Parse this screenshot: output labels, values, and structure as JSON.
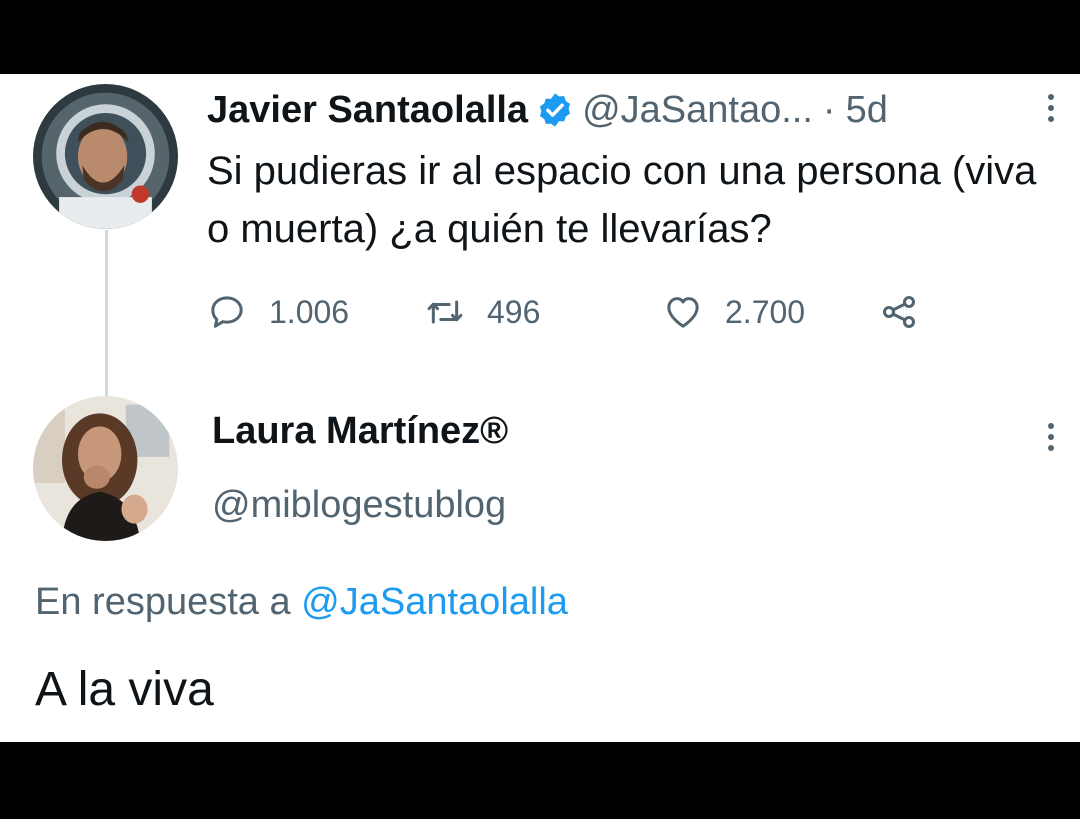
{
  "tweet": {
    "author_name": "Javier Santaolalla",
    "author_handle": "@JaSantao...",
    "separator": "·",
    "age": "5d",
    "text": "Si pudieras ir al espacio con una persona (viva o muerta) ¿a quién te llevarías?",
    "replies": "1.006",
    "retweets": "496",
    "likes": "2.700",
    "verified": true
  },
  "reply": {
    "author_name": "Laura Martínez®",
    "author_handle": "@miblogestublog",
    "replying_prefix": "En respuesta a",
    "replying_to": "@JaSantaolalla",
    "text": "A la viva"
  },
  "colors": {
    "text_primary": "#0f1419",
    "text_secondary": "#536471",
    "accent": "#1d9bf0",
    "thread_line": "#cfd9de",
    "letterbox": "#000000"
  },
  "icons": [
    "verified-badge-icon",
    "more-options-icon",
    "reply-icon",
    "retweet-icon",
    "like-icon",
    "share-icon"
  ]
}
